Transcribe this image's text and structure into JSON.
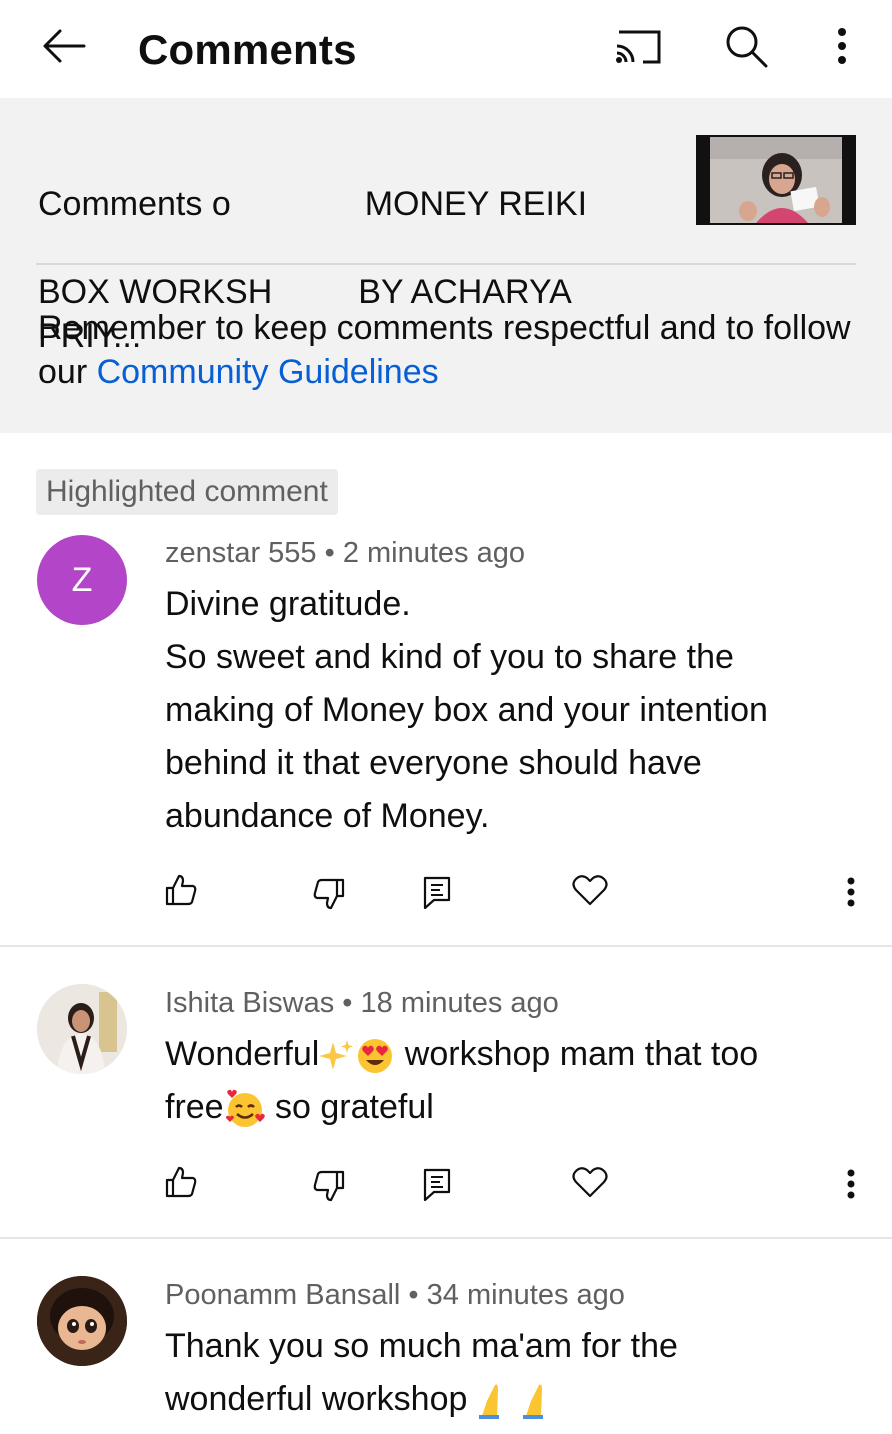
{
  "header": {
    "title": "Comments",
    "icons": [
      "back-arrow-icon",
      "cast-icon",
      "search-icon",
      "more-vertical-icon"
    ]
  },
  "video_info": {
    "title_line1": "Comments o",
    "title_line1_tail": "MONEY REIKI",
    "title_line2_head": "BOX WORKSH",
    "title_line2_tail": "BY ACHARYA PRIY..."
  },
  "notice": {
    "text": "Remember to keep comments respectful and to follow our ",
    "link": "Community Guidelines"
  },
  "highlight_chip": "Highlighted comment",
  "comments": [
    {
      "author": "zenstar 555",
      "separator": "•",
      "time": "2 minutes ago",
      "avatar_letter": "Z",
      "avatar_color": "#b245c8",
      "lines": [
        "Divine gratitude.",
        "So sweet and kind of you to share the",
        "making of Money box and your intention",
        "behind it that everyone should have",
        "abundance of Money."
      ]
    },
    {
      "author": "Ishita Biswas",
      "separator": "•",
      "time": "18 minutes ago",
      "line1_a": "Wonderful",
      "line1_b": " workshop mam that too",
      "line2_a": "free",
      "line2_b": " so grateful"
    },
    {
      "author": "Poonamm Bansall",
      "separator": "•",
      "time": "34 minutes ago",
      "line1": "Thank you so much ma'am for the",
      "line2": "wonderful workshop"
    }
  ],
  "colors": {
    "link": "#065fd4",
    "secondary_text": "#606060",
    "panel_bg": "#f2f2f2",
    "icon": "#0f0f0f"
  }
}
